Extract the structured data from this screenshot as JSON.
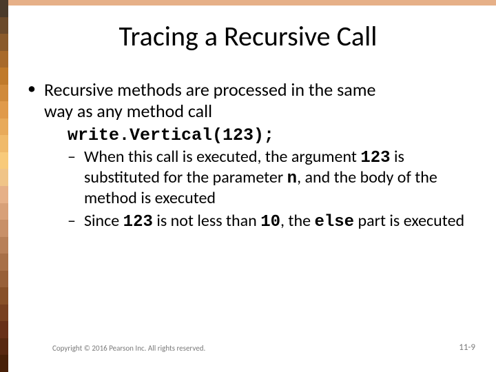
{
  "title": "Tracing a Recursive Call",
  "bullet1_a": "Recursive methods are processed in the same",
  "bullet1_b": "way as any method call",
  "code_line": "write.Vertical(123);",
  "sub1_a": "When this call is executed, the argument ",
  "sub1_code1": "123",
  "sub1_b": " is substituted for the parameter ",
  "sub1_code2": "n",
  "sub1_c": ", and the body of the method is executed",
  "sub2_a": "Since ",
  "sub2_code1": "123",
  "sub2_b": " is not less than ",
  "sub2_code2": "10",
  "sub2_c": ", the ",
  "sub2_code3": "else",
  "sub2_d": " part is executed",
  "copyright": "Copyright © 2016 Pearson Inc. All rights reserved.",
  "page_num": "11-9",
  "stripe_colors": [
    "#4a3a2a",
    "#6b4a2a",
    "#8a5a2a",
    "#a86a2a",
    "#c07a2a",
    "#d08a3a",
    "#e09a4a",
    "#e8aa5a",
    "#f0ba6a",
    "#f8ca7a",
    "#f0c488",
    "#e6b088",
    "#d8a078",
    "#c89068",
    "#b88058",
    "#a87048",
    "#986038",
    "#885028",
    "#784020",
    "#683018",
    "#582810",
    "#482008"
  ]
}
